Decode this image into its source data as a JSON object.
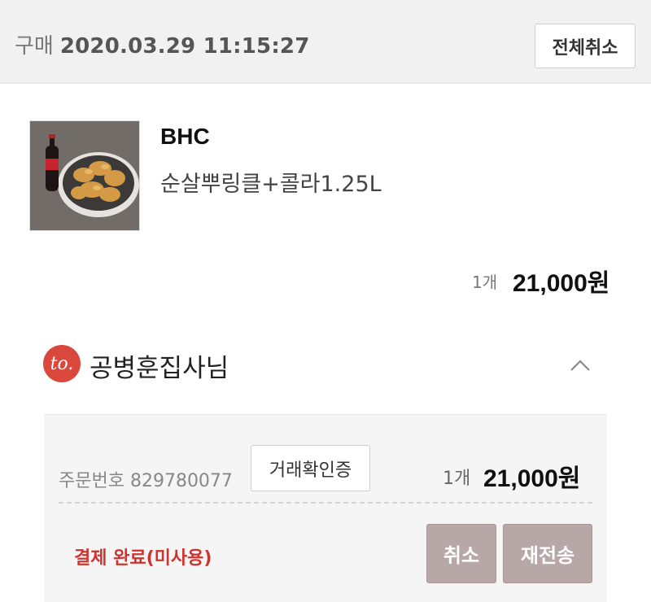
{
  "header": {
    "purchase_label": "구매",
    "purchase_datetime": "2020.03.29 11:15:27",
    "cancel_all_label": "전체취소"
  },
  "product": {
    "brand": "BHC",
    "name": "순살뿌링클+콜라1.25L",
    "quantity": "1개",
    "price": "21,000원"
  },
  "recipient": {
    "badge": "to.",
    "name": "공병훈집사님"
  },
  "order": {
    "order_number": "주문번호 829780077",
    "verify_label": "거래확인증",
    "quantity": "1개",
    "price": "21,000원",
    "status": "결제 완료(미사용)",
    "cancel_label": "취소",
    "resend_label": "재전송"
  },
  "colors": {
    "accent_red": "#d0332f",
    "badge_red": "#d9473d",
    "action_button": "#b8a7a7"
  }
}
